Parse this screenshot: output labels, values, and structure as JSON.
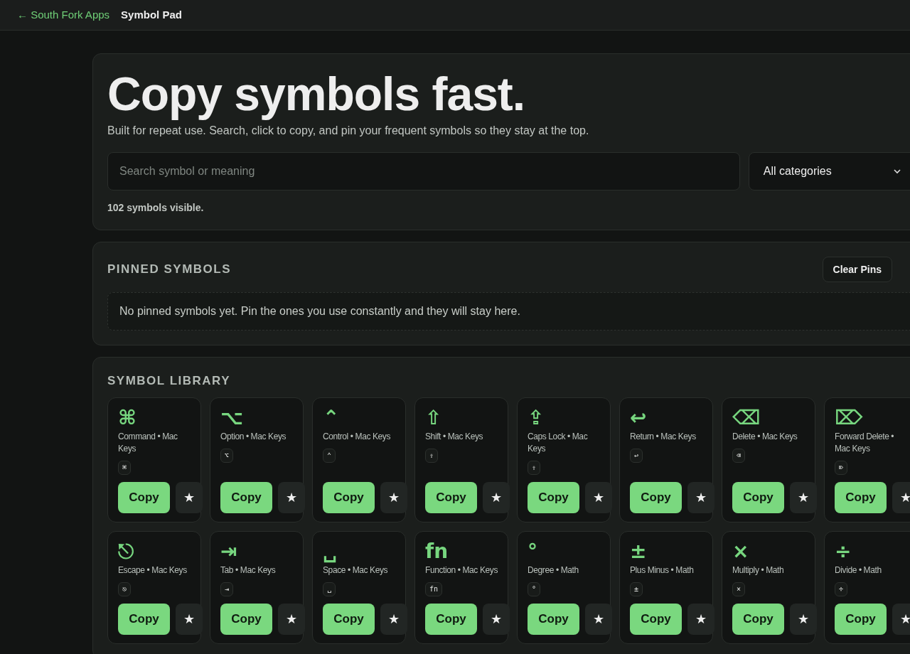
{
  "nav": {
    "back_link": "← South Fork Apps",
    "title": "Symbol Pad"
  },
  "hero": {
    "heading": "Copy symbols fast.",
    "subtitle": "Built for repeat use. Search, click to copy, and pin your frequent symbols so they stay at the top.",
    "search": {
      "placeholder": "Search symbol or meaning"
    },
    "category_select": {
      "value": "All categories"
    },
    "count": "102 symbols visible."
  },
  "pinned": {
    "heading": "PINNED SYMBOLS",
    "clear_button": "Clear Pins",
    "empty_message": "No pinned symbols yet. Pin the ones you use constantly and they will stay here."
  },
  "library": {
    "heading": "SYMBOL LIBRARY",
    "symbols": [
      {
        "glyph": "⌘",
        "label": "Command • Mac Keys",
        "key": "⌘",
        "copy": "Copy",
        "pin": "★"
      },
      {
        "glyph": "⌥",
        "label": "Option • Mac Keys",
        "key": "⌥",
        "copy": "Copy",
        "pin": "★"
      },
      {
        "glyph": "⌃",
        "label": "Control • Mac Keys",
        "key": "⌃",
        "copy": "Copy",
        "pin": "★"
      },
      {
        "glyph": "⇧",
        "label": "Shift • Mac Keys",
        "key": "⇧",
        "copy": "Copy",
        "pin": "★"
      },
      {
        "glyph": "⇪",
        "label": "Caps Lock • Mac Keys",
        "key": "⇪",
        "copy": "Copy",
        "pin": "★"
      },
      {
        "glyph": "↩",
        "label": "Return • Mac Keys",
        "key": "↩",
        "copy": "Copy",
        "pin": "★"
      },
      {
        "glyph": "⌫",
        "label": "Delete • Mac Keys",
        "key": "⌫",
        "copy": "Copy",
        "pin": "★"
      },
      {
        "glyph": "⌦",
        "label": "Forward Delete • Mac Keys",
        "key": "⌦",
        "copy": "Copy",
        "pin": "★"
      },
      {
        "glyph": "⎋",
        "label": "Escape • Mac Keys",
        "key": "⎋",
        "copy": "Copy",
        "pin": "★"
      },
      {
        "glyph": "⇥",
        "label": "Tab • Mac Keys",
        "key": "⇥",
        "copy": "Copy",
        "pin": "★"
      },
      {
        "glyph": "␣",
        "label": "Space • Mac Keys",
        "key": "␣",
        "copy": "Copy",
        "pin": "★"
      },
      {
        "glyph": "fn",
        "label": "Function • Mac Keys",
        "key": "fn",
        "copy": "Copy",
        "pin": "★"
      },
      {
        "glyph": "°",
        "label": "Degree • Math",
        "key": "°",
        "copy": "Copy",
        "pin": "★"
      },
      {
        "glyph": "±",
        "label": "Plus Minus • Math",
        "key": "±",
        "copy": "Copy",
        "pin": "★"
      },
      {
        "glyph": "×",
        "label": "Multiply • Math",
        "key": "×",
        "copy": "Copy",
        "pin": "★"
      },
      {
        "glyph": "÷",
        "label": "Divide • Math",
        "key": "÷",
        "copy": "Copy",
        "pin": "★"
      }
    ]
  }
}
